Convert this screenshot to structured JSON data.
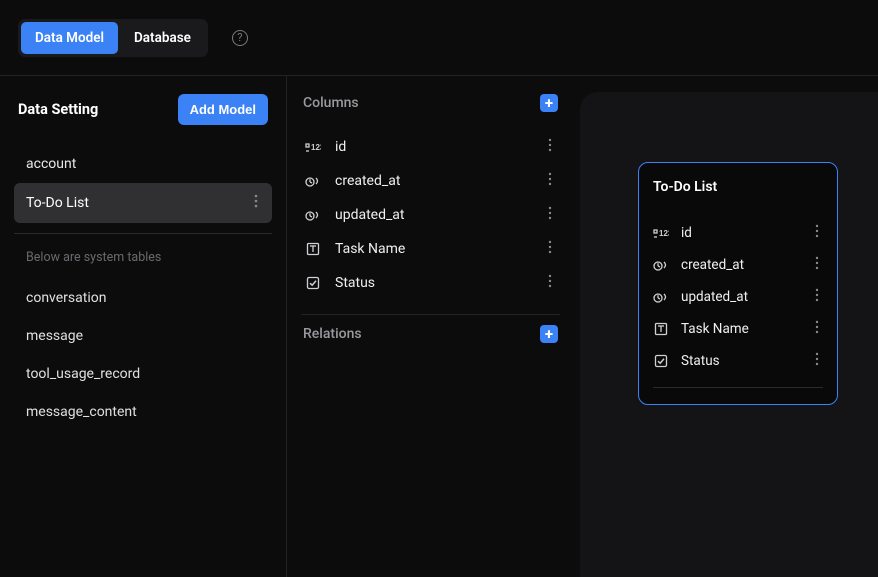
{
  "tabs": {
    "data_model": "Data Model",
    "database": "Database"
  },
  "sidebar": {
    "title": "Data Setting",
    "add_model": "Add Model",
    "user_tables": [
      {
        "name": "account"
      },
      {
        "name": "To-Do List",
        "active": true
      }
    ],
    "system_note": "Below are system tables",
    "system_tables": [
      {
        "name": "conversation"
      },
      {
        "name": "message"
      },
      {
        "name": "tool_usage_record"
      },
      {
        "name": "message_content"
      }
    ]
  },
  "columns_panel": {
    "columns_header": "Columns",
    "relations_header": "Relations",
    "columns": [
      {
        "icon": "pk",
        "name": "id"
      },
      {
        "icon": "time",
        "name": "created_at"
      },
      {
        "icon": "time",
        "name": "updated_at"
      },
      {
        "icon": "text",
        "name": "Task Name"
      },
      {
        "icon": "checkbox",
        "name": "Status"
      }
    ]
  },
  "node": {
    "title": "To-Do List",
    "columns": [
      {
        "icon": "pk",
        "name": "id"
      },
      {
        "icon": "time",
        "name": "created_at"
      },
      {
        "icon": "time",
        "name": "updated_at"
      },
      {
        "icon": "text",
        "name": "Task Name"
      },
      {
        "icon": "checkbox",
        "name": "Status"
      }
    ]
  }
}
